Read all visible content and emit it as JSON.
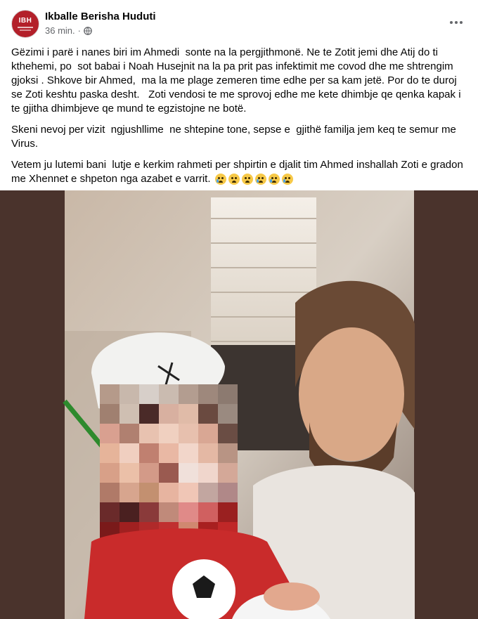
{
  "post": {
    "author_name": "Ikballe Berisha Huduti",
    "timestamp": "36 min.",
    "separator": "·",
    "avatar_text": "IBH",
    "privacy_icon": "globe-icon",
    "more_icon": "more-options-icon",
    "paragraphs": [
      "Gëzimi i parë i nanes biri im Ahmedi  sonte na la pergjithmonë. Ne te Zotit jemi dhe Atij do ti kthehemi, po  sot babai i Noah Husejnit na la pa prit pas infektimit me covod dhe me shtrengim gjoksi . Shkove bir Ahmed,  ma la me plage zemeren time edhe per sa kam jetë. Por do te duroj se Zoti keshtu paska desht.   Zoti vendosi te me sprovoj edhe me kete dhimbje qe qenka kapak i te gjitha dhimbjeve qe mund te egzistojne ne botë.",
      "Skeni nevoj per vizit  ngjushllime  ne shtepine tone, sepse e  gjithë familja jem keq te semur me Virus.",
      "Vetem ju lutemi bani  lutje e kerkim rahmeti per shpirtin e djalit tim Ahmed inshallah Zoti e gradon me Xhennet e shpeton nga azabet e varrit."
    ],
    "emojis": [
      "crying-face",
      "sad-face",
      "sad-face",
      "crying-face",
      "crying-face",
      "crying-face"
    ]
  },
  "colors": {
    "frame": "#4a332c",
    "avatar_brand": "#b3202a",
    "meta_text": "#65676b"
  }
}
